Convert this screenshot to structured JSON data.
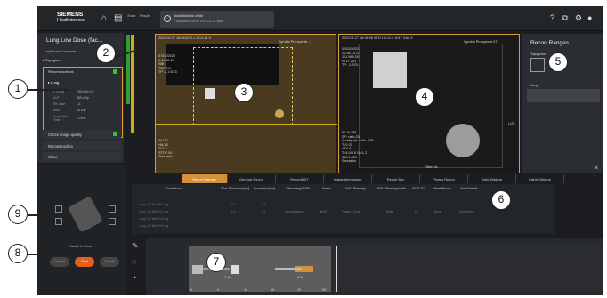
{
  "topbar": {
    "brand": "SIEMENS",
    "brand_sub": "Healthineers",
    "patient_label": "########## ####",
    "patient_sub": "* ######## ## ## 2023-02-27 ####",
    "mini1": "Exam",
    "mini2": "Results"
  },
  "left_panel": {
    "protocol_title": "Lung Low Dose (fac...",
    "protocol_sub": "myExam Compare",
    "topogram": "Topogram",
    "reconstructions": "Reconstructions",
    "lung": "Lung",
    "params": [
      {
        "k": "CTDIvol",
        "v": "130 mGy 0.3"
      },
      {
        "k": "DLP",
        "v": "300 mGy"
      },
      {
        "k": "Eff. dose",
        "v": "1.1"
      },
      {
        "k": "mAs",
        "v": "34 100"
      },
      {
        "k": "Acquisition Time",
        "v": "2.29 s"
      }
    ],
    "check_quality": "Check image quality",
    "reconstruction": "Reconstruction",
    "close": "Close"
  },
  "viewer1": {
    "top_left": "2023.02.27 18:08:57/0.1 1 0.0 11.0",
    "top_right": "Symbia Pro specta ...",
    "lines": [
      "07/02/2023",
      "9,49.39.29",
      "Still 1",
      "TOP 1/1",
      "TP: 2.1 00.5"
    ],
    "bottom_left": [
      "W:110",
      "HA:15",
      "TI:2.2",
      "STOP 00",
      "Simulator"
    ]
  },
  "viewer2": {
    "top_left": "2023.02.27 18:08:58 STD:1 0.12.0 1017.3:68.3",
    "top_right": "Symbia Pro specta X7",
    "lines": [
      "07/02/2023",
      "20.38.15.15",
      "101.989.29",
      "RTD: 201",
      "TP: -1.970.0"
    ],
    "bottom_left": [
      "W: 5+188",
      "SP: ratio 20",
      "Quality ref. mAs: 108",
      "TI:0.20",
      "1T:0.0",
      "TI:4.0/0.0 Sp:1.2",
      "388.0 800",
      "Simulator"
    ],
    "filter": "Filter: 0s",
    "right_label": "L/20"
  },
  "right_panel": {
    "title": "Recon Ranges",
    "topogram": "Topogram",
    "lung": "Lung"
  },
  "tabs": [
    "Recon Ranges",
    "General Recon",
    "Recon/BDT",
    "Image Impression",
    "Recon Box",
    "Physio Recon",
    "Auto Tasking",
    "Inline Options"
  ],
  "grid": {
    "headers": [
      "ScanRecon",
      "Slice Thickness [mm]",
      "Increment [mm]",
      "Windowing/CNRV",
      "Kernel",
      "VAST Planning",
      "FAST Planning Width",
      "FAST 3D",
      "Inline Results",
      "Multi Results"
    ],
    "rows": [
      [
        "Lung 1,00 Br40 R:1 reg",
        "1.0",
        "0.7",
        "",
        "",
        "",
        "",
        "",
        "",
        ""
      ],
      [
        "Lung 1,00 Br40 R:1 reg",
        "1.0",
        "0.7",
        "Lung/Abdomen",
        "Br40",
        "Thorax - Lung",
        "Body",
        "On",
        "None",
        "Dual Recon"
      ],
      [
        "Lung 1,00 Br40 R:2 reg",
        "",
        "",
        "",
        "",
        "",
        "",
        "",
        "",
        ""
      ],
      [
        "Lung 1,00 Br40 R:2 reg",
        "",
        "",
        "",
        "",
        "",
        "",
        "",
        "",
        ""
      ]
    ]
  },
  "lower_left": {
    "switch_label": "Switch to Dose",
    "btn_left": "Cancel",
    "btn_start": "Start",
    "btn_right": "Cancel"
  },
  "timeline": {
    "label1": "2.3s",
    "label2": "5.5s",
    "ticks": [
      "0",
      "5",
      "10",
      "15",
      "20",
      "25"
    ]
  },
  "callouts": [
    "1",
    "2",
    "3",
    "4",
    "5",
    "6",
    "7",
    "8",
    "9"
  ],
  "colors": {
    "accent": "#d5903a",
    "ok": "#3cbf3c"
  }
}
